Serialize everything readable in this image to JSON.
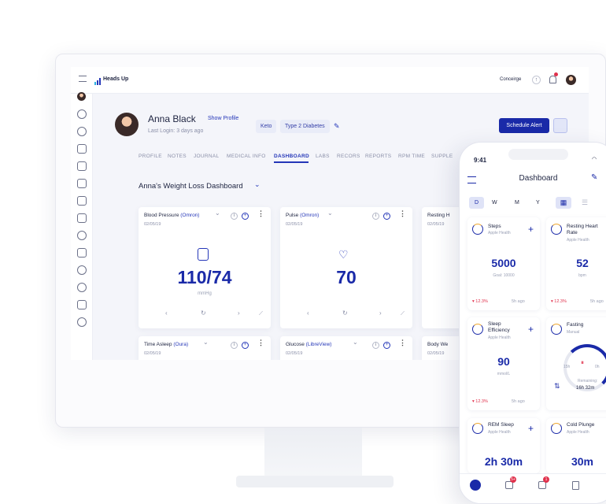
{
  "app": {
    "brand": "Heads Up"
  },
  "header": {
    "concierge": "Conceirge",
    "notification_count": ""
  },
  "patient": {
    "name": "Anna Black",
    "show_profile": "Show Profile",
    "last_login": "Last Login: 3 days ago",
    "tags": [
      "Keto",
      "Type 2 Diabetes"
    ]
  },
  "actions": {
    "schedule_alert": "Schedule Alert"
  },
  "tabs": [
    "PROFILE",
    "NOTES",
    "JOURNAL",
    "MEDICAL INFO",
    "DASHBOARD",
    "LABS",
    "RECORS",
    "REPORTS",
    "RPM TIME",
    "SUPPLE"
  ],
  "active_tab": "DASHBOARD",
  "dashboard": {
    "title": "Anna's Weight Loss Dashboard"
  },
  "cards": [
    {
      "title": "Blood Pressure",
      "source": "(Omron)",
      "date": "02/05/19",
      "value": "110/74",
      "unit": "mmHg"
    },
    {
      "title": "Pulse",
      "source": "(Omron)",
      "date": "02/05/19",
      "value": "70",
      "unit": ""
    },
    {
      "title": "Resting H",
      "source": "",
      "date": "02/05/19",
      "value": "",
      "unit": ""
    },
    {
      "title": "Time Asleep",
      "source": "(Oura)",
      "date": "02/05/19"
    },
    {
      "title": "Glucose",
      "source": "(LibreView)",
      "date": "02/05/19"
    },
    {
      "title": "Body We",
      "source": "",
      "date": "02/05/19"
    }
  ],
  "phone": {
    "time": "9:41",
    "title": "Dashboard",
    "periods": [
      "D",
      "W",
      "M",
      "Y"
    ],
    "cards": [
      {
        "title": "Steps",
        "sub": "Apple Health",
        "value": "5000",
        "note": "Goal: 10000",
        "change": "▾ 12.3%",
        "ago": "5h ago"
      },
      {
        "title": "Resting Heart Rate",
        "sub": "Apple Health",
        "value": "52",
        "note": "bpm",
        "change": "▾ 12.3%",
        "ago": "5h ago"
      },
      {
        "title": "Sleep Efficiency",
        "sub": "Apple Health",
        "value": "90",
        "note": "mmol/L",
        "change": "▾ 12.3%",
        "ago": "5h ago"
      },
      {
        "title": "Fasting",
        "sub": "Manual",
        "value": "",
        "note": "",
        "change": "",
        "ago": ""
      },
      {
        "title": "REM Sleep",
        "sub": "Apple Health",
        "value": "2h 30m"
      },
      {
        "title": "Cold Plunge",
        "sub": "Apple Health",
        "value": "30m"
      }
    ],
    "fasting": {
      "start": "15h",
      "end": "0h",
      "remaining_label": "Remaining:",
      "remaining": "16h 32m"
    },
    "bottom_badges": [
      "5+",
      "1"
    ]
  },
  "colors": {
    "primary": "#1a2aa8",
    "background": "#f4f5fa",
    "negative": "#e0314c"
  }
}
